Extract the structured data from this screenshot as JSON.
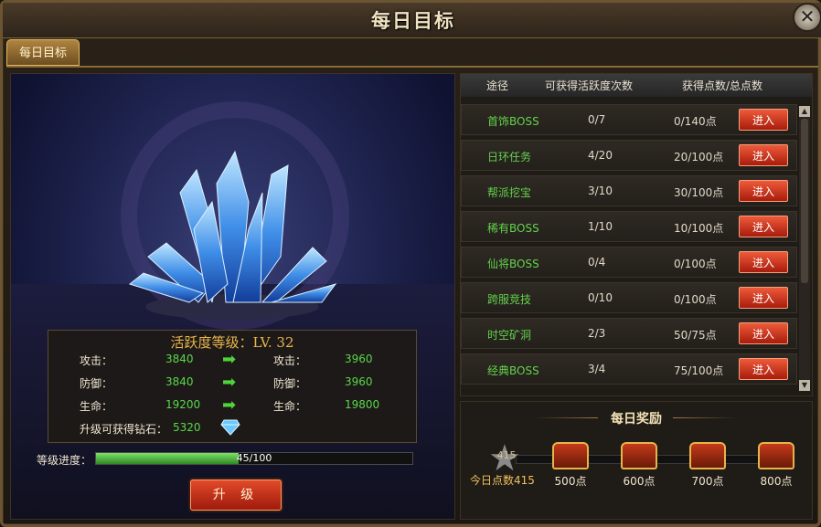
{
  "window": {
    "title": "每日目标",
    "close_label": "✕"
  },
  "tabs": [
    {
      "label": "每日目标"
    }
  ],
  "left_panel": {
    "level_text": "活跃度等级：LV. 32",
    "stats": [
      {
        "label": "攻击：",
        "current": "3840",
        "next_label": "攻击：",
        "next": "3960"
      },
      {
        "label": "防御：",
        "current": "3840",
        "next_label": "防御：",
        "next": "3960"
      },
      {
        "label": "生命：",
        "current": "19200",
        "next_label": "生命：",
        "next": "19800"
      }
    ],
    "diamond_label": "升级可获得钻石：",
    "diamond_value": "5320",
    "progress_label": "等级进度：",
    "progress_text": "45/100",
    "progress_fraction": 0.45,
    "upgrade_button": "升 级"
  },
  "table": {
    "headers": [
      "途径",
      "可获得活跃度次数",
      "获得点数/总点数"
    ],
    "rows": [
      {
        "name": "首饰BOSS",
        "count": "0/7",
        "points": "0/140点",
        "button": "进入"
      },
      {
        "name": "日环任务",
        "count": "4/20",
        "points": "20/100点",
        "button": "进入"
      },
      {
        "name": "帮派挖宝",
        "count": "3/10",
        "points": "30/100点",
        "button": "进入"
      },
      {
        "name": "稀有BOSS",
        "count": "1/10",
        "points": "10/100点",
        "button": "进入"
      },
      {
        "name": "仙将BOSS",
        "count": "0/4",
        "points": "0/100点",
        "button": "进入"
      },
      {
        "name": "跨服竞技",
        "count": "0/10",
        "points": "0/100点",
        "button": "进入"
      },
      {
        "name": "时空矿洞",
        "count": "2/3",
        "points": "50/75点",
        "button": "进入"
      },
      {
        "name": "经典BOSS",
        "count": "3/4",
        "points": "75/100点",
        "button": "进入"
      }
    ]
  },
  "rewards": {
    "title": "每日奖励",
    "star_value": "415",
    "today_text": "今日点数415",
    "milestones": [
      {
        "label": "500点"
      },
      {
        "label": "600点"
      },
      {
        "label": "700点"
      },
      {
        "label": "800点"
      }
    ]
  },
  "colors": {
    "accent_green": "#59d84a",
    "button_red": "#c8301a",
    "gold": "#e9b84a"
  }
}
